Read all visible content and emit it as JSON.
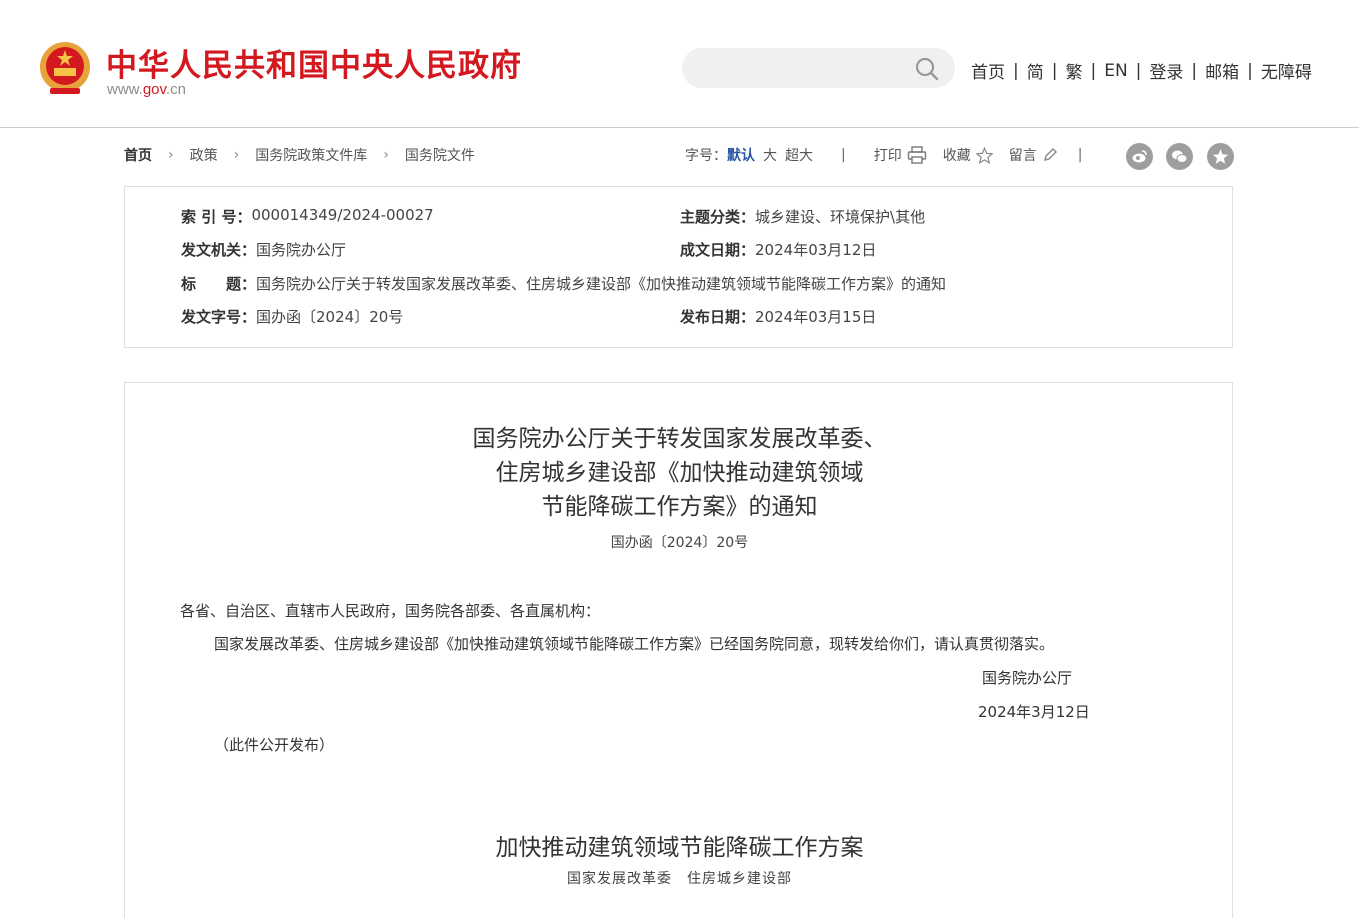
{
  "header": {
    "site_title": "中华人民共和国中央人民政府",
    "domain_prefix": "www.",
    "domain_gov": "gov",
    "domain_suffix": ".cn",
    "search_placeholder": "",
    "nav": [
      "首页",
      "简",
      "繁",
      "EN",
      "登录",
      "邮箱",
      "无障碍"
    ],
    "nav_separator": "|"
  },
  "breadcrumb": {
    "items": [
      "首页",
      "政策",
      "国务院政策文件库",
      "国务院文件"
    ],
    "chevron": "›"
  },
  "tools": {
    "font_label": "字号：",
    "font_default": "默认",
    "font_large": "大",
    "font_xlarge": "超大",
    "divider": "|",
    "print": "打印",
    "favorite": "收藏",
    "comment": "留言"
  },
  "info": {
    "index_label": "索 引 号：",
    "index_value": "000014349/2024-00027",
    "topic_label": "主题分类：",
    "topic_value": "城乡建设、环境保护\\其他",
    "issuer_label": "发文机关：",
    "issuer_value": "国务院办公厅",
    "date_label": "成文日期：",
    "date_value": "2024年03月12日",
    "title_label": "标　　题：",
    "title_value": "国务院办公厅关于转发国家发展改革委、住房城乡建设部《加快推动建筑领域节能降碳工作方案》的通知",
    "docno_label": "发文字号：",
    "docno_value": "国办函〔2024〕20号",
    "pubdate_label": "发布日期：",
    "pubdate_value": "2024年03月15日"
  },
  "article": {
    "title_line1": "国务院办公厅关于转发国家发展改革委、",
    "title_line2": "住房城乡建设部《加快推动建筑领域",
    "title_line3": "节能降碳工作方案》的通知",
    "doc_number": "国办函〔2024〕20号",
    "salutation": "各省、自治区、直辖市人民政府，国务院各部委、各直属机构：",
    "body": "国家发展改革委、住房城乡建设部《加快推动建筑领域节能降碳工作方案》已经国务院同意，现转发给你们，请认真贯彻落实。",
    "signature": "国务院办公厅",
    "sign_date": "2024年3月12日",
    "public_note": "（此件公开发布）",
    "plan_title": "加快推动建筑领域节能降碳工作方案",
    "plan_issuers": "国家发展改革委　住房城乡建设部"
  },
  "colors": {
    "brand_red": "#d4181f",
    "accent_blue": "#2a56a5",
    "border": "#dde1e6"
  },
  "icons": [
    "national-emblem-icon",
    "search-icon",
    "printer-icon",
    "star-icon",
    "pencil-icon",
    "weibo-icon",
    "wechat-icon",
    "favorite-icon"
  ]
}
